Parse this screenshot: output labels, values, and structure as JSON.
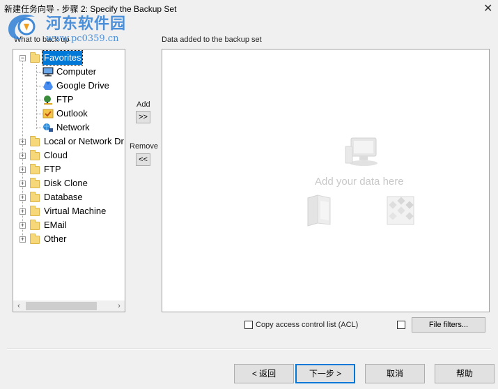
{
  "window": {
    "title": "新建任务向导 - 步骤 2: Specify the Backup Set",
    "close_symbol": "✕"
  },
  "watermark": {
    "name": "河东软件园",
    "url": "www.pc0359.cn"
  },
  "left": {
    "heading": "What to back up",
    "tree": {
      "favorites": {
        "label": "Favorites",
        "expander": "−",
        "children": [
          {
            "label": "Computer",
            "icon": "computer-icon"
          },
          {
            "label": "Google Drive",
            "icon": "google-drive-icon"
          },
          {
            "label": "FTP",
            "icon": "ftp-icon"
          },
          {
            "label": "Outlook",
            "icon": "outlook-icon"
          },
          {
            "label": "Network",
            "icon": "network-icon"
          }
        ]
      },
      "roots": [
        {
          "label": "Local or Network Dr",
          "expander": "+"
        },
        {
          "label": "Cloud",
          "expander": "+"
        },
        {
          "label": "FTP",
          "expander": "+"
        },
        {
          "label": "Disk Clone",
          "expander": "+"
        },
        {
          "label": "Database",
          "expander": "+"
        },
        {
          "label": "Virtual Machine",
          "expander": "+"
        },
        {
          "label": "EMail",
          "expander": "+"
        },
        {
          "label": "Other",
          "expander": "+"
        }
      ]
    },
    "scroll": {
      "left_arrow": "‹",
      "right_arrow": "›"
    }
  },
  "middle": {
    "add_label": "Add",
    "add_button": ">>",
    "remove_label": "Remove",
    "remove_button": "<<"
  },
  "right": {
    "heading": "Data added to the backup set",
    "placeholder": "Add your data here"
  },
  "options": {
    "acl_label": "Copy access control list (ACL)",
    "acl_checked": false,
    "filter_checked": false,
    "file_filters_button": "File filters..."
  },
  "footer": {
    "back": "< 返回",
    "next": "下一步 >",
    "cancel": "取消",
    "help": "帮助"
  },
  "colors": {
    "selection": "#0078d7",
    "folder": "#f6d77a",
    "watermark": "#2f7fd6"
  }
}
